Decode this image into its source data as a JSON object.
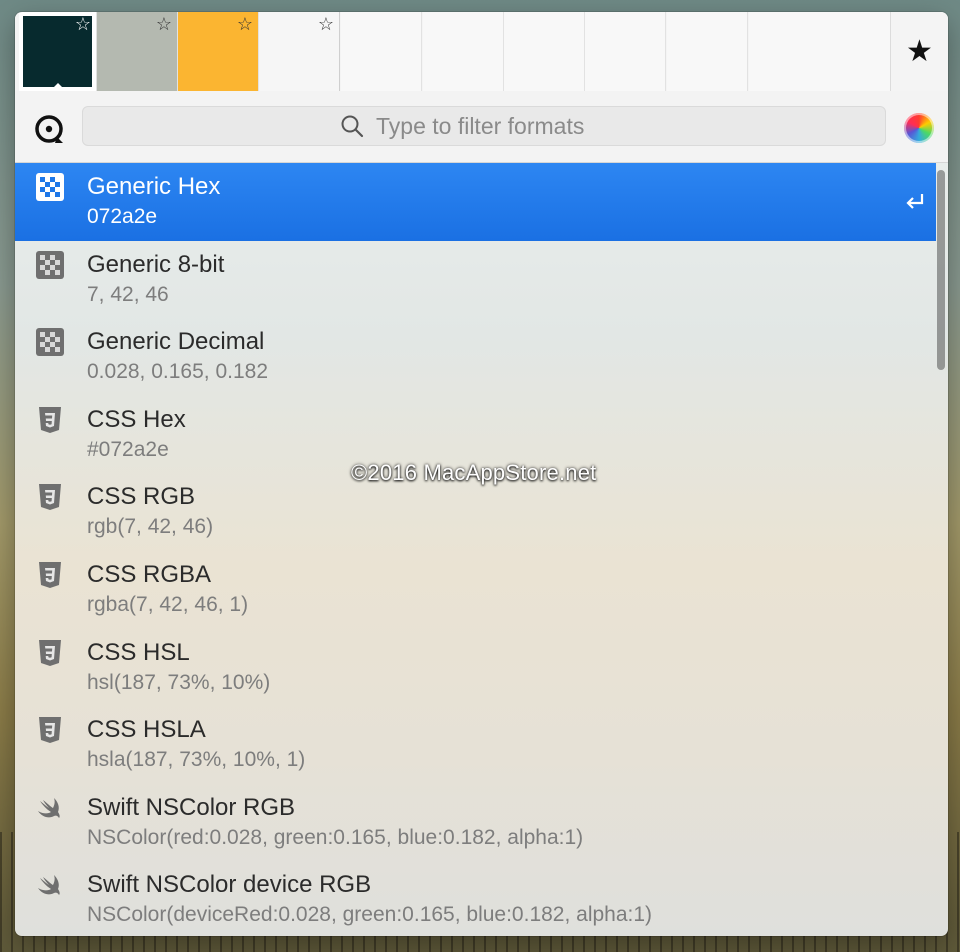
{
  "swatches": [
    {
      "color": "#072a2e",
      "selected": true
    },
    {
      "color": "#b4b9b0",
      "selected": false
    },
    {
      "color": "#fbb531",
      "selected": false
    },
    {
      "color": "#f6f6f6",
      "selected": false
    }
  ],
  "empty_slots": 6,
  "search": {
    "placeholder": "Type to filter formats"
  },
  "formats": [
    {
      "icon": "checker-icon",
      "title": "Generic Hex",
      "value": "072a2e",
      "selected": true
    },
    {
      "icon": "checker-icon",
      "title": "Generic 8-bit",
      "value": "7, 42, 46"
    },
    {
      "icon": "checker-icon",
      "title": "Generic Decimal",
      "value": "0.028, 0.165, 0.182"
    },
    {
      "icon": "css3-icon",
      "title": "CSS Hex",
      "value": "#072a2e"
    },
    {
      "icon": "css3-icon",
      "title": "CSS RGB",
      "value": "rgb(7, 42, 46)"
    },
    {
      "icon": "css3-icon",
      "title": "CSS RGBA",
      "value": "rgba(7, 42, 46, 1)"
    },
    {
      "icon": "css3-icon",
      "title": "CSS HSL",
      "value": "hsl(187, 73%, 10%)"
    },
    {
      "icon": "css3-icon",
      "title": "CSS HSLA",
      "value": "hsla(187, 73%, 10%, 1)"
    },
    {
      "icon": "swift-icon",
      "title": "Swift NSColor RGB",
      "value": "NSColor(red:0.028, green:0.165, blue:0.182, alpha:1)"
    },
    {
      "icon": "swift-icon",
      "title": "Swift NSColor device RGB",
      "value": "NSColor(deviceRed:0.028, green:0.165, blue:0.182, alpha:1)"
    }
  ],
  "watermark": "©2016 MacAppStore.net",
  "colors": {
    "accent": "#1f78e8"
  }
}
